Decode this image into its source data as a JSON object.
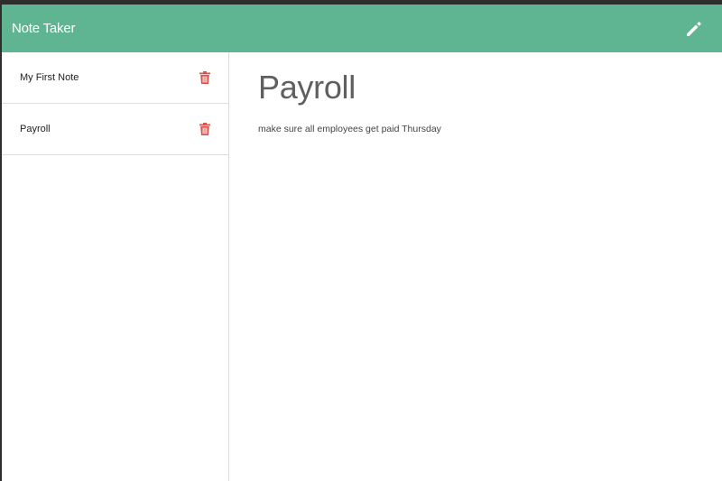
{
  "navbar": {
    "title": "Note Taker",
    "edit_icon": "pencil-icon",
    "background": "#5fb592"
  },
  "sidebar": {
    "notes": [
      {
        "title": "My First Note",
        "icon": "trash-icon"
      },
      {
        "title": "Payroll",
        "icon": "trash-icon"
      }
    ],
    "delete_color": "#d9534f"
  },
  "main": {
    "note_title": "Payroll",
    "note_text": "make sure all employees get paid Thursday"
  }
}
